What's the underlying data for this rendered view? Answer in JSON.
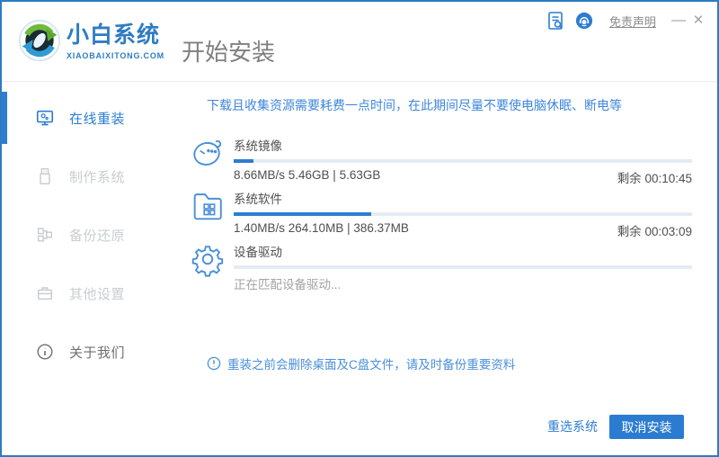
{
  "header": {
    "brand_name": "小白系统",
    "brand_domain": "XIAOBAIXITONG.COM",
    "page_title": "开始安装",
    "disclaimer_link": "免责声明",
    "minimize_glyph": "—",
    "close_glyph": "×"
  },
  "sidebar": {
    "items": [
      {
        "label": "在线重装",
        "icon": "monitor-icon",
        "state": "active"
      },
      {
        "label": "制作系统",
        "icon": "usb-drive-icon",
        "state": "disabled"
      },
      {
        "label": "备份还原",
        "icon": "backup-blocks-icon",
        "state": "disabled"
      },
      {
        "label": "其他设置",
        "icon": "toolbox-icon",
        "state": "disabled"
      },
      {
        "label": "关于我们",
        "icon": "info-circle-icon",
        "state": "normal"
      }
    ]
  },
  "main": {
    "notice": "下载且收集资源需要耗费一点时间，在此期间尽量不要使电脑休眠、断电等",
    "tasks": [
      {
        "name": "系统镜像",
        "icon": "mascot-face-icon",
        "progress_pct": 4.3,
        "stats": "8.66MB/s 5.46GB | 5.63GB",
        "remaining": "剩余 00:10:45"
      },
      {
        "name": "系统软件",
        "icon": "folder-apps-icon",
        "progress_pct": 30,
        "stats": "1.40MB/s 264.10MB | 386.37MB",
        "remaining": "剩余 00:03:09"
      },
      {
        "name": "设备驱动",
        "icon": "gear-icon",
        "progress_pct": 0,
        "stats": "正在匹配设备驱动...",
        "remaining": ""
      }
    ],
    "backup_note": "重装之前会删除桌面及C盘文件，请及时备份重要资料"
  },
  "footer": {
    "reselect_button": "重选系统",
    "cancel_button": "取消安装"
  },
  "colors": {
    "accent": "#2d7dd2",
    "window_border": "#2e7cc3",
    "notice_text": "#3e86dd",
    "progress_track": "#e4ebf3",
    "inactive_gray": "#c9cdd2",
    "cancel_button_bg": "#2b7bd0"
  }
}
